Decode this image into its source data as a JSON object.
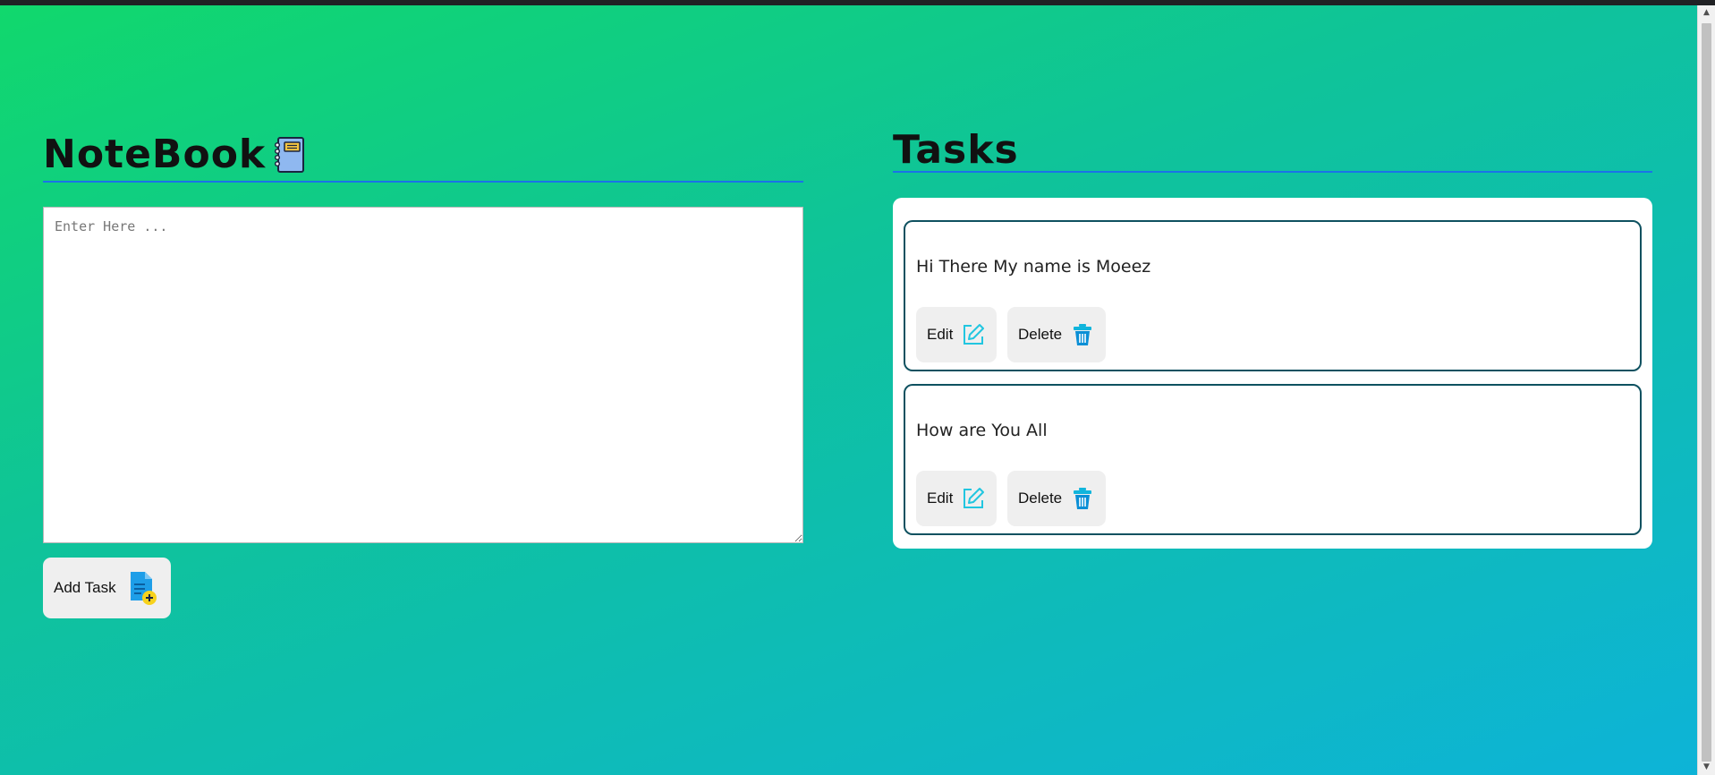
{
  "notebook": {
    "title": "NoteBook",
    "title_icon": "notebook-icon",
    "input_placeholder": "Enter Here ...",
    "input_value": "",
    "add_button_label": "Add Task",
    "add_button_icon": "add-document-icon"
  },
  "tasks": {
    "title": "Tasks",
    "items": [
      {
        "text": "Hi There My name is Moeez",
        "edit_label": "Edit",
        "delete_label": "Delete"
      },
      {
        "text": "How are You All",
        "edit_label": "Edit",
        "delete_label": "Delete"
      }
    ]
  },
  "colors": {
    "background_gradient": [
      "#11d86c",
      "#0db3d8"
    ],
    "rule": "#1a73e8",
    "card_border": "#0e5160",
    "button_bg": "#efefef",
    "edit_icon": "#22c6e0",
    "delete_icon": "#0a8fd6"
  }
}
